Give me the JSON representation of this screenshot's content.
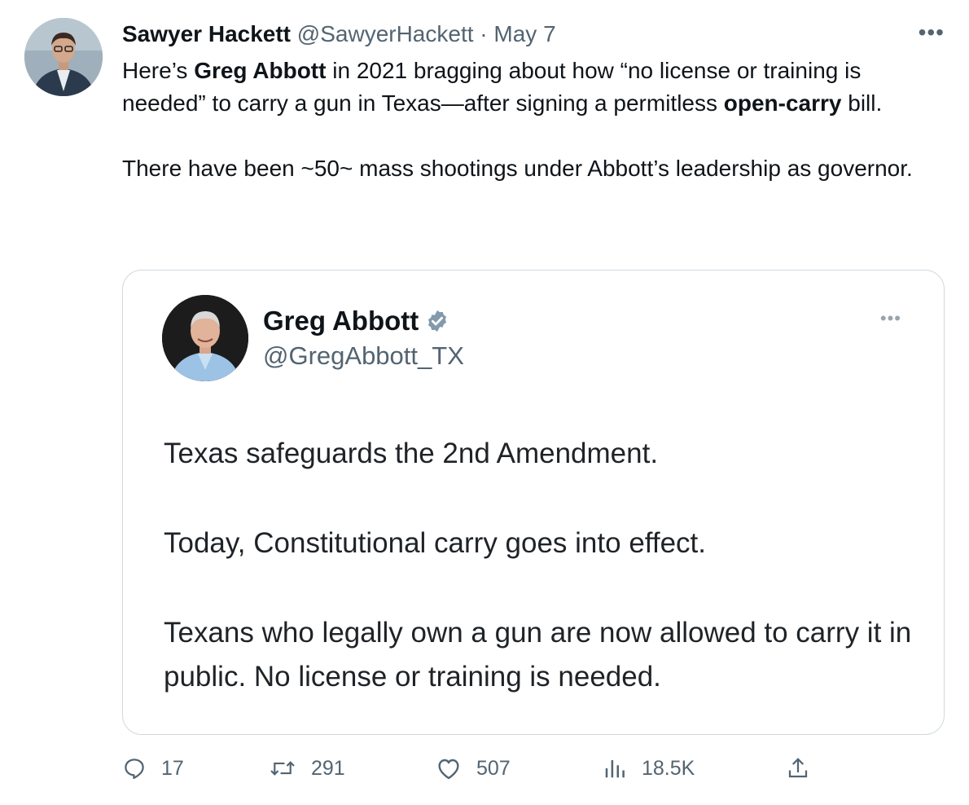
{
  "tweet": {
    "author_name": "Sawyer Hackett",
    "author_handle": "@SawyerHackett",
    "separator": "·",
    "date": "May 7",
    "more": "•••",
    "text": {
      "p1_a": "Here’s ",
      "p1_b": "Greg Abbott",
      "p1_c": " in 2021 bragging about how “no license or training is needed” to carry a gun in Texas—after signing a permitless ",
      "p1_d": "open-carry",
      "p1_e": " bill.",
      "p2": "There have been ~50~ mass shootings under Abbott’s leadership as governor."
    }
  },
  "quoted": {
    "name": "Greg Abbott",
    "handle": "@GregAbbott_TX",
    "more": "•••",
    "lines": [
      "Texas safeguards the 2nd Amendment.",
      "Today, Constitutional carry goes into effect.",
      "Texans who legally own a gun are now allowed to carry it in public. No license or training is needed."
    ]
  },
  "actions": {
    "replies": "17",
    "retweets": "291",
    "likes": "507",
    "views": "18.5K"
  },
  "colors": {
    "text": "#0f1419",
    "secondary": "#536471",
    "border": "#cfd9de",
    "verified_badge": "#829aab"
  }
}
